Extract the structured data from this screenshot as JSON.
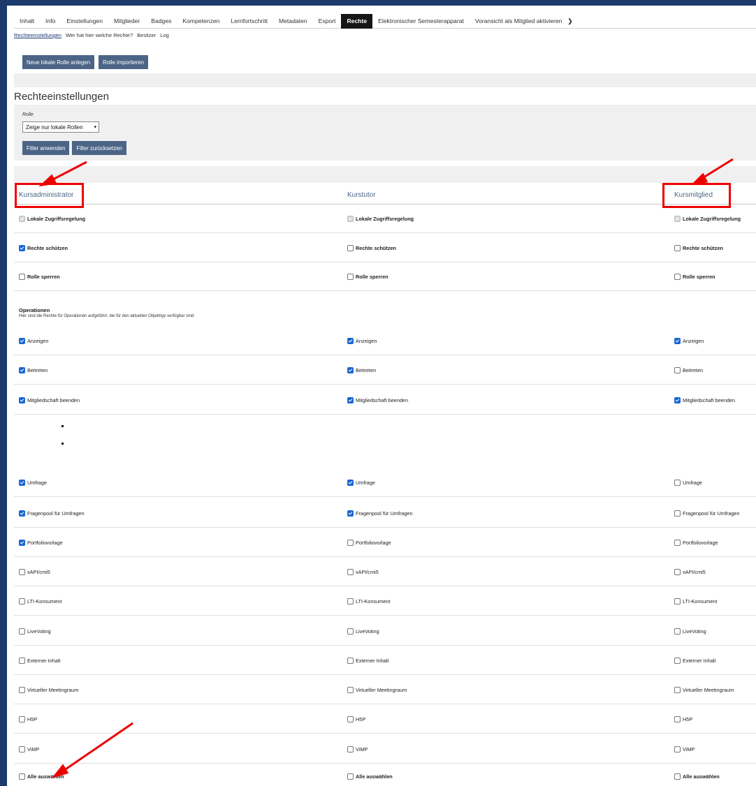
{
  "tabs": [
    "Inhalt",
    "Info",
    "Einstellungen",
    "Mitglieder",
    "Badges",
    "Kompetenzen",
    "Lernfortschritt",
    "Metadaten",
    "Export",
    "Rechte",
    "Elektronischer Semesterapparat",
    "Voransicht als Mitglied aktivieren"
  ],
  "tabs_active": "Rechte",
  "subtabs": [
    "Rechteeinstellungen",
    "Wer hat hier welche Rechte?",
    "Besitzer",
    "Log"
  ],
  "buttons": {
    "new_role": "Neue lokale Rolle anlegen",
    "import_role": "Rolle importieren"
  },
  "heading": "Rechteeinstellungen",
  "filter": {
    "label": "Rolle",
    "select_value": "Zeige nur lokale Rollen",
    "apply": "Filter anwenden",
    "reset": "Filter zurücksetzen"
  },
  "columns": [
    "Kursadministrator",
    "Kurstutor",
    "Kursmitglied"
  ],
  "operations": {
    "title": "Operationen",
    "description": "Hier sind die Rechte für Operationen aufgeführt, die für den aktuellen Objekttyp verfügbar sind."
  },
  "accent": "#4c6586",
  "checkbox_color": "#1a66d2",
  "annotation_color": "#ee0000",
  "rows": [
    {
      "label": "Lokale Zugriffsregelung",
      "bold": true,
      "states": [
        "disabled",
        "disabled",
        "disabled"
      ]
    },
    {
      "label": "Rechte schützen",
      "bold": true,
      "states": [
        "on",
        "off",
        "off"
      ]
    },
    {
      "label": "Rolle sperren",
      "bold": true,
      "states": [
        "off",
        "off",
        "off"
      ]
    },
    {
      "label": "Anzeigen",
      "bold": false,
      "states": [
        "on",
        "on",
        "on"
      ]
    },
    {
      "label": "Beitreten",
      "bold": false,
      "states": [
        "on",
        "on",
        "off"
      ]
    },
    {
      "label": "Mitgliedschaft beenden",
      "bold": false,
      "states": [
        "on",
        "on",
        "on"
      ]
    },
    {
      "label": "Umfrage",
      "bold": false,
      "states": [
        "on",
        "on",
        "off"
      ]
    },
    {
      "label": "Fragenpool für Umfragen",
      "bold": false,
      "states": [
        "on",
        "on",
        "off"
      ]
    },
    {
      "label": "Portfoliovorlage",
      "bold": false,
      "states": [
        "on",
        "off",
        "off"
      ]
    },
    {
      "label": "xAPI/cmi5",
      "bold": false,
      "states": [
        "off",
        "off",
        "off"
      ]
    },
    {
      "label": "LTI-Konsument",
      "bold": false,
      "states": [
        "off",
        "off",
        "off"
      ]
    },
    {
      "label": "LiveVoting",
      "bold": false,
      "states": [
        "off",
        "off",
        "off"
      ]
    },
    {
      "label": "Externer Inhalt",
      "bold": false,
      "states": [
        "off",
        "off",
        "off"
      ]
    },
    {
      "label": "Virtueller Meetingraum",
      "bold": false,
      "states": [
        "off",
        "off",
        "off"
      ]
    },
    {
      "label": "H5P",
      "bold": false,
      "states": [
        "off",
        "off",
        "off"
      ]
    },
    {
      "label": "ViMP",
      "bold": false,
      "states": [
        "off",
        "off",
        "off"
      ]
    },
    {
      "label": "Alle auswählen",
      "bold": true,
      "states": [
        "off",
        "off",
        "off"
      ]
    }
  ]
}
